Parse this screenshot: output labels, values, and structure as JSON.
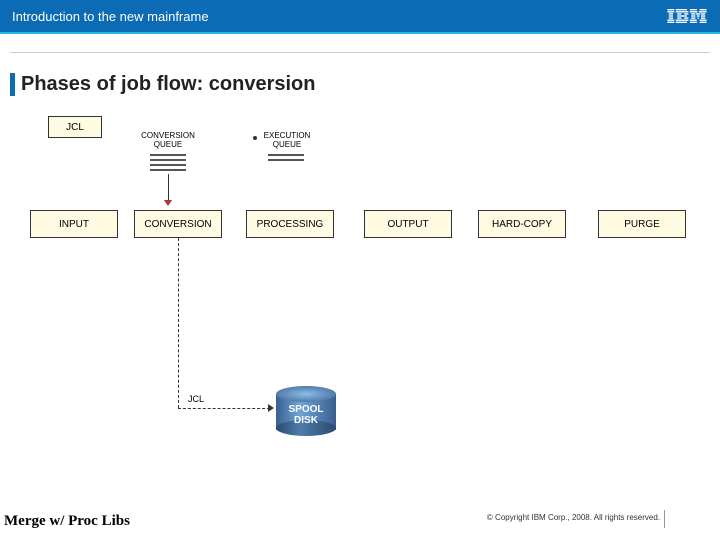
{
  "header": {
    "title": "Introduction to the new mainframe",
    "logo_label": "IBM"
  },
  "page": {
    "title": "Phases of job flow: conversion"
  },
  "diagram": {
    "jcl_box": "JCL",
    "conversion_queue_label": "CONVERSION\nQUEUE",
    "execution_queue_label": "EXECUTION\nQUEUE",
    "jcl_path_label": "JCL",
    "spool_disk": "SPOOL\nDISK",
    "phases": [
      "INPUT",
      "CONVERSION",
      "PROCESSING",
      "OUTPUT",
      "HARD-COPY",
      "PURGE"
    ]
  },
  "footer": {
    "left": "Merge w/ Proc Libs",
    "copyright": "© Copyright IBM Corp., 2008. All rights reserved."
  }
}
